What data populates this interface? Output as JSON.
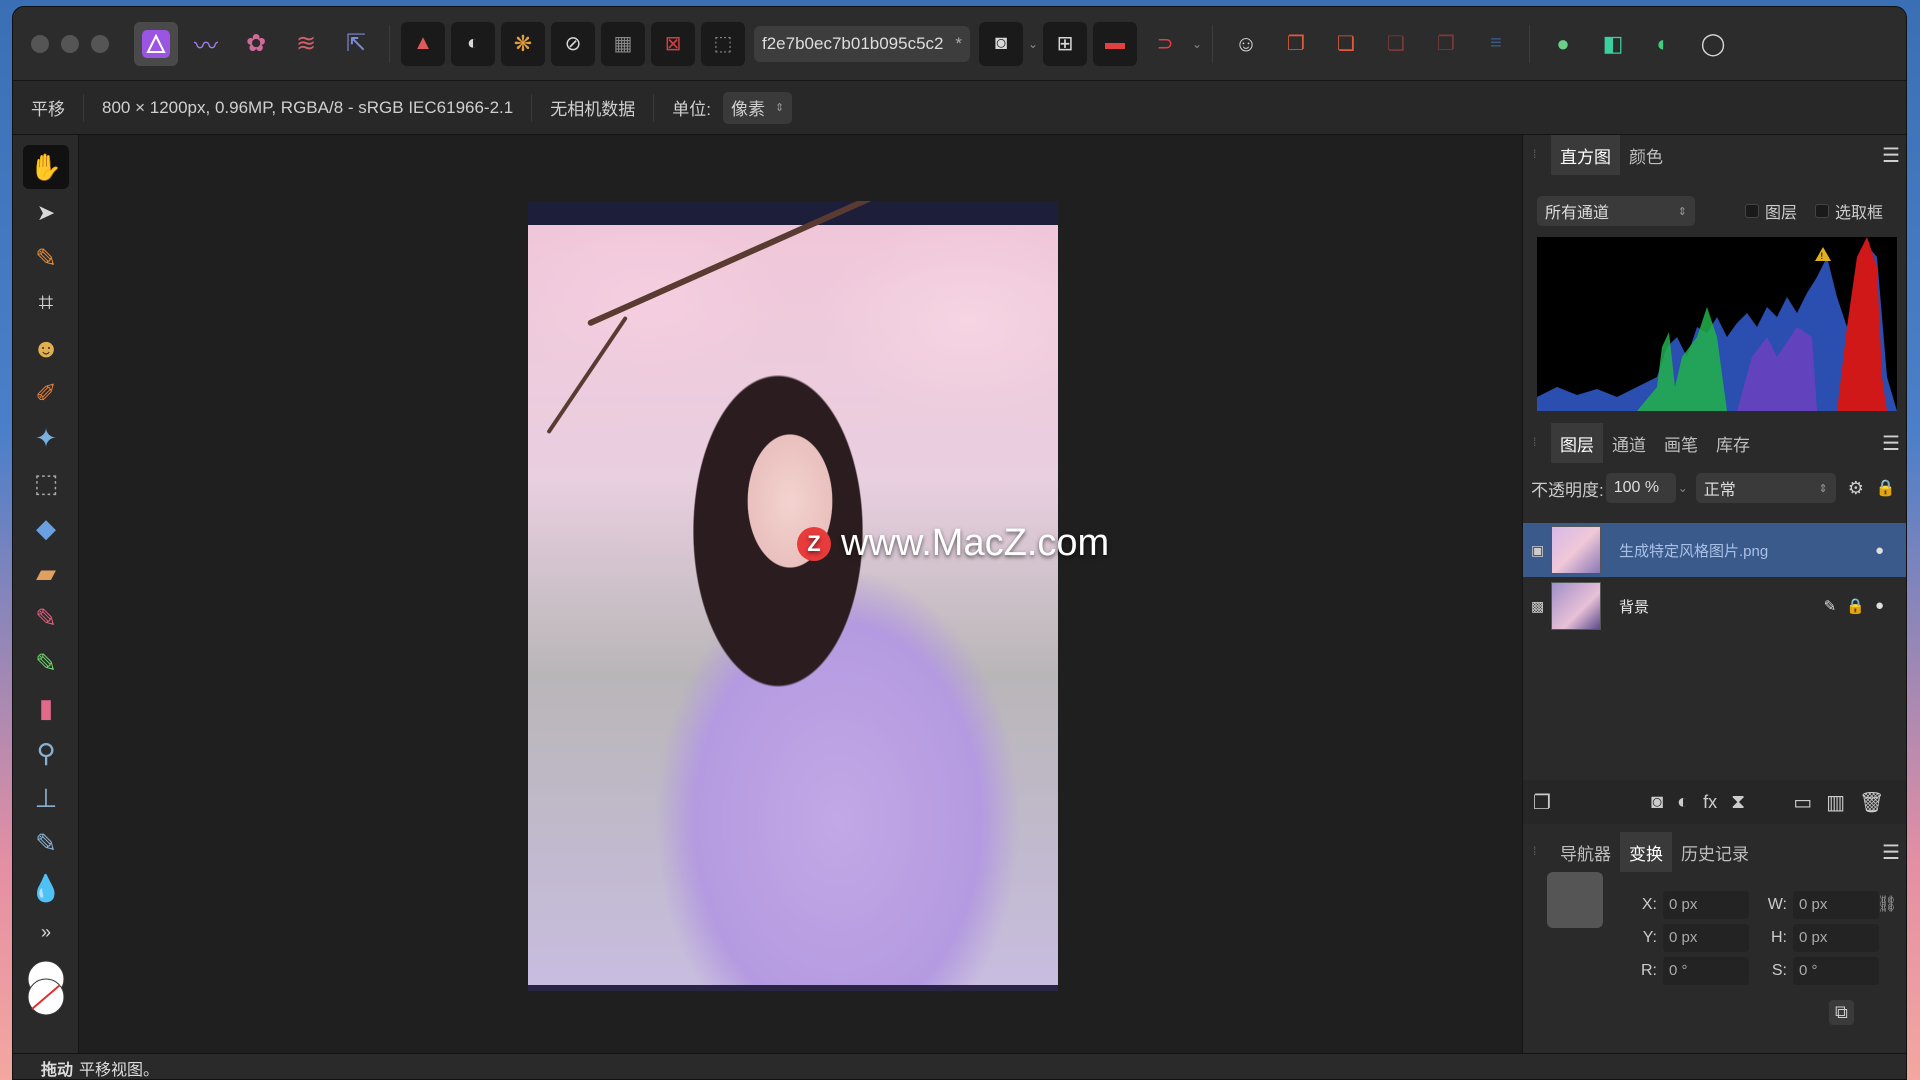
{
  "toolbar": {
    "document_name": "f2e7b0ec7b01b095c5c2",
    "document_modified_marker": "*",
    "accent": "#9b55e3"
  },
  "contextbar": {
    "tool_name": "平移",
    "document_info": "800 × 1200px, 0.96MP, RGBA/8 - sRGB IEC61966-2.1",
    "camera_data": "无相机数据",
    "units_label": "单位:",
    "units_value": "像素"
  },
  "canvas": {
    "watermark_text": "www.MacZ.com",
    "watermark_logo": "Z"
  },
  "histogram_panel": {
    "tabs": [
      "直方图",
      "颜色"
    ],
    "active_tab": "直方图",
    "channel_select": "所有通道",
    "checkbox_layer": "图层",
    "checkbox_marquee": "选取框"
  },
  "layers_panel": {
    "tabs": [
      "图层",
      "通道",
      "画笔",
      "库存"
    ],
    "active_tab": "图层",
    "opacity_label": "不透明度:",
    "opacity_value": "100 %",
    "blend_mode": "正常",
    "layers": [
      {
        "name": "生成特定风格图片.png",
        "selected": true
      },
      {
        "name": "背景",
        "selected": false
      }
    ]
  },
  "transform_panel": {
    "tabs": [
      "导航器",
      "变换",
      "历史记录"
    ],
    "active_tab": "变换",
    "x_label": "X:",
    "x_value": "0 px",
    "y_label": "Y:",
    "y_value": "0 px",
    "w_label": "W:",
    "w_value": "0 px",
    "h_label": "H:",
    "h_value": "0 px",
    "r_label": "R:",
    "r_value": "0 °",
    "s_label": "S:",
    "s_value": "0 °"
  },
  "statusbar": {
    "action": "拖动",
    "description": "平移视图。"
  }
}
